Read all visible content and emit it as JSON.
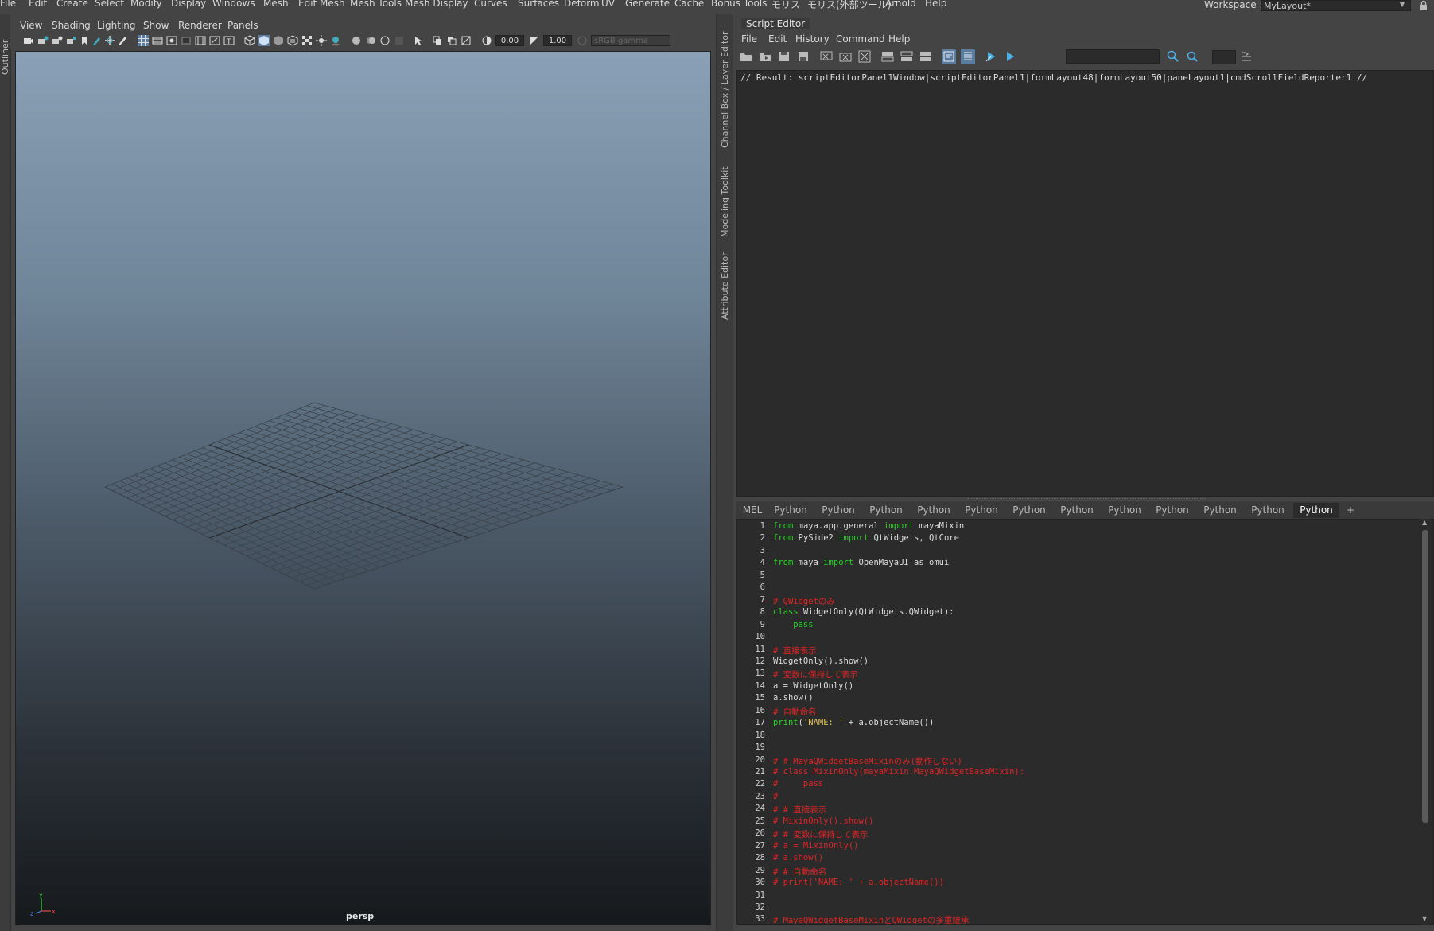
{
  "main_menu": [
    "File",
    "Edit",
    "Create",
    "Select",
    "Modify",
    "Display",
    "Windows",
    "Mesh",
    "Edit Mesh",
    "Mesh Tools",
    "Mesh Display",
    "Curves",
    "Surfaces",
    "Deform",
    "UV",
    "Generate",
    "Cache",
    "Bonus Tools",
    "モリス",
    "モリス(外部ツール)",
    "Arnold",
    "Help"
  ],
  "workspace": {
    "label": "Workspace :",
    "value": "MyLayout*"
  },
  "side_tabs": {
    "outliner": "Outliner",
    "channel_box": "Channel Box / Layer Editor",
    "modeling_toolkit": "Modeling Toolkit",
    "attribute_editor": "Attribute Editor"
  },
  "viewport": {
    "menu": [
      "View",
      "Shading",
      "Lighting",
      "Show",
      "Renderer",
      "Panels"
    ],
    "exposure": "0.00",
    "gamma": "1.00",
    "color_space": "sRGB gamma",
    "camera": "persp",
    "axis": {
      "y": "y",
      "x": "x",
      "z": "z"
    }
  },
  "script_editor": {
    "title": "Script Editor",
    "menu": [
      "File",
      "Edit",
      "History",
      "Command",
      "Help"
    ],
    "output": "// Result: scriptEditorPanel1Window|scriptEditorPanel1|formLayout48|formLayout50|paneLayout1|cmdScrollFieldReporter1 //",
    "tabs": [
      "MEL",
      "Python",
      "Python",
      "Python",
      "Python",
      "Python",
      "Python",
      "Python",
      "Python",
      "Python",
      "Python",
      "Python",
      "Python",
      "+"
    ],
    "active_tab_index": 12,
    "code_lines": [
      {
        "n": "1",
        "parts": [
          [
            "kw",
            "from"
          ],
          [
            "tx",
            " maya.app.general "
          ],
          [
            "kw",
            "import"
          ],
          [
            "tx",
            " mayaMixin"
          ]
        ]
      },
      {
        "n": "2",
        "parts": [
          [
            "kw",
            "from"
          ],
          [
            "tx",
            " PySide2 "
          ],
          [
            "kw",
            "import"
          ],
          [
            "tx",
            " QtWidgets, QtCore"
          ]
        ]
      },
      {
        "n": "3",
        "parts": []
      },
      {
        "n": "4",
        "parts": [
          [
            "kw",
            "from"
          ],
          [
            "tx",
            " maya "
          ],
          [
            "kw",
            "import"
          ],
          [
            "tx",
            " OpenMayaUI as omui"
          ]
        ]
      },
      {
        "n": "5",
        "parts": []
      },
      {
        "n": "6",
        "parts": []
      },
      {
        "n": "7",
        "parts": [
          [
            "cm",
            "# QWidgetのみ"
          ]
        ]
      },
      {
        "n": "8",
        "parts": [
          [
            "kw",
            "class"
          ],
          [
            "tx",
            " WidgetOnly(QtWidgets.QWidget):"
          ]
        ]
      },
      {
        "n": "9",
        "parts": [
          [
            "kw",
            "    pass"
          ]
        ]
      },
      {
        "n": "10",
        "parts": []
      },
      {
        "n": "11",
        "parts": [
          [
            "cm",
            "# 直接表示"
          ]
        ]
      },
      {
        "n": "12",
        "parts": [
          [
            "tx",
            "WidgetOnly().show()"
          ]
        ]
      },
      {
        "n": "13",
        "parts": [
          [
            "cm",
            "# 変数に保持して表示"
          ]
        ]
      },
      {
        "n": "14",
        "parts": [
          [
            "tx",
            "a = WidgetOnly()"
          ]
        ]
      },
      {
        "n": "15",
        "parts": [
          [
            "tx",
            "a.show()"
          ]
        ]
      },
      {
        "n": "16",
        "parts": [
          [
            "cm",
            "# 自動命名"
          ]
        ]
      },
      {
        "n": "17",
        "parts": [
          [
            "kw",
            "print"
          ],
          [
            "tx",
            "("
          ],
          [
            "st",
            "'NAME: '"
          ],
          [
            "tx",
            " + a.objectName())"
          ]
        ]
      },
      {
        "n": "18",
        "parts": []
      },
      {
        "n": "19",
        "parts": []
      },
      {
        "n": "20",
        "parts": [
          [
            "cm",
            "# # MayaQWidgetBaseMixinのみ(動作しない)"
          ]
        ]
      },
      {
        "n": "21",
        "parts": [
          [
            "cm",
            "# class MixinOnly(mayaMixin.MayaQWidgetBaseMixin):"
          ]
        ]
      },
      {
        "n": "22",
        "parts": [
          [
            "cm",
            "#     pass"
          ]
        ]
      },
      {
        "n": "23",
        "parts": [
          [
            "cm",
            "#"
          ]
        ]
      },
      {
        "n": "24",
        "parts": [
          [
            "cm",
            "# # 直接表示"
          ]
        ]
      },
      {
        "n": "25",
        "parts": [
          [
            "cm",
            "# MixinOnly().show()"
          ]
        ]
      },
      {
        "n": "26",
        "parts": [
          [
            "cm",
            "# # 変数に保持して表示"
          ]
        ]
      },
      {
        "n": "27",
        "parts": [
          [
            "cm",
            "# a = MixinOnly()"
          ]
        ]
      },
      {
        "n": "28",
        "parts": [
          [
            "cm",
            "# a.show()"
          ]
        ]
      },
      {
        "n": "29",
        "parts": [
          [
            "cm",
            "# # 自動命名"
          ]
        ]
      },
      {
        "n": "30",
        "parts": [
          [
            "cm",
            "# print('NAME: ' + a.objectName())"
          ]
        ]
      },
      {
        "n": "31",
        "parts": []
      },
      {
        "n": "32",
        "parts": []
      },
      {
        "n": "33",
        "parts": [
          [
            "cm",
            "# MayaQWidgetBaseMixinとQWidgetの多重継承"
          ]
        ]
      }
    ]
  },
  "colors": {
    "keyword": "#28d428",
    "comment": "#e02424",
    "string": "#e0c050",
    "panel": "#444444",
    "field": "#2b2b2b"
  }
}
